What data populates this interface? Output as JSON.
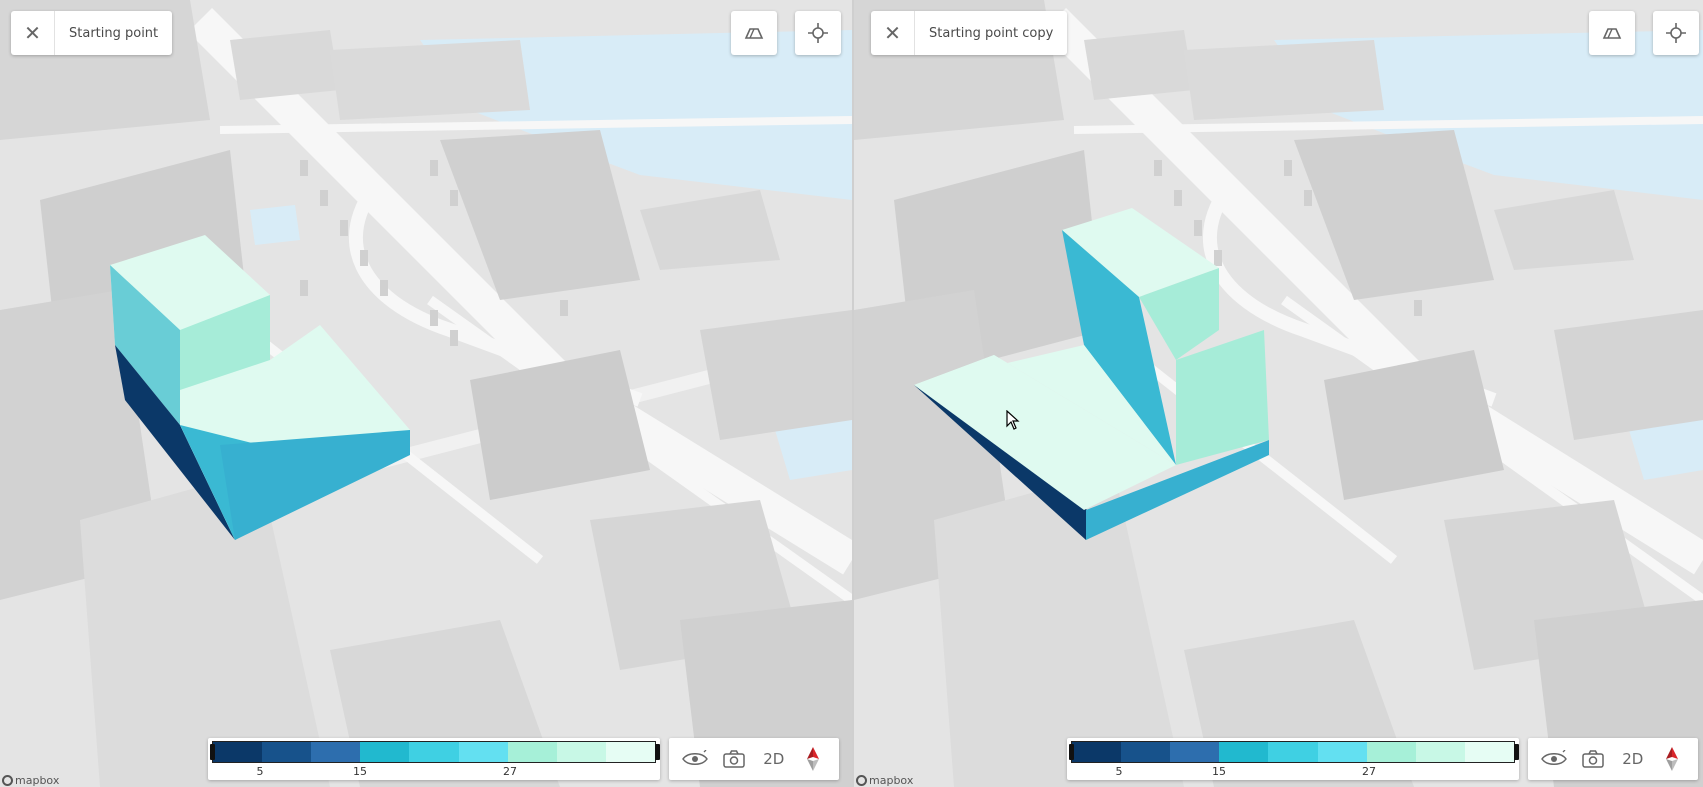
{
  "panes": [
    {
      "title": "Starting point",
      "close_icon": "close-icon",
      "legend": {
        "ticks": [
          "5",
          "15",
          "27"
        ]
      }
    },
    {
      "title": "Starting point copy",
      "close_icon": "close-icon",
      "legend": {
        "ticks": [
          "5",
          "15",
          "27"
        ]
      }
    }
  ],
  "legend_colors": [
    "#0b3868",
    "#17528b",
    "#2d6eae",
    "#21b9cf",
    "#3fd0e3",
    "#63e0f1",
    "#a6f0d8",
    "#c8f8e6",
    "#e6fdf4"
  ],
  "toolbar": {
    "view_mode_label": "2D",
    "eye_icon": "eye-icon",
    "camera_icon": "camera-icon",
    "compass_icon": "compass-icon"
  },
  "top_right_icons": [
    "tilt-icon",
    "locate-icon"
  ],
  "attribution": {
    "brand": "mapbox"
  },
  "colors": {
    "water": "#d8ecf7",
    "ground": "#e4e4e4",
    "road": "#f7f7f7",
    "building": "#d4d4d4",
    "accent_red": "#d9262b"
  }
}
